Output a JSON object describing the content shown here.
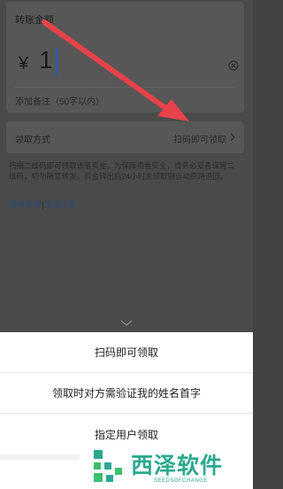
{
  "transfer": {
    "amount_title": "转账金额",
    "currency_symbol": "¥",
    "amount_value": "1",
    "remark_placeholder": "添加备注（50字以内）"
  },
  "method": {
    "label": "领取方式",
    "value": "扫码即可领取"
  },
  "tip": "扫描二维码即可领取该笔资金。为保障资金安全，请务必妥善保管二维码，切勿随意转发。资金转出后24小时未领取则自动原路退回。",
  "links": {
    "help": "使用说明",
    "separator": "|",
    "records": "使用记录"
  },
  "sheet": {
    "options": [
      "扫码即可领取",
      "领取时对方需验证我的姓名首字",
      "指定用户领取"
    ]
  },
  "watermark": {
    "title": "西泽软件",
    "subtitle": "SEEDSOFCHANGE"
  },
  "colors": {
    "arrow": "#e8424a",
    "cursor": "#1f5fb3",
    "watermark": "#2aa890"
  }
}
